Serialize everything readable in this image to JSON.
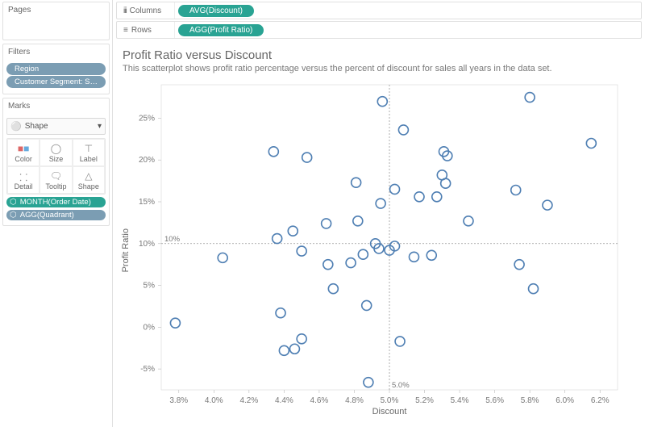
{
  "leftPanel": {
    "pages": {
      "title": "Pages"
    },
    "filters": {
      "title": "Filters",
      "items": [
        "Region",
        "Customer Segment: Small Busin…"
      ]
    },
    "marks": {
      "title": "Marks",
      "shapeSelect": "Shape",
      "grid": [
        "Color",
        "Size",
        "Label",
        "Detail",
        "Tooltip",
        "Shape"
      ],
      "fields": [
        {
          "label": "MONTH(Order Date)",
          "cls": "fp-green"
        },
        {
          "label": "AGG(Quadrant)",
          "cls": "fp-blue"
        }
      ]
    }
  },
  "shelves": {
    "columns": {
      "label": "Columns",
      "pill": "AVG(Discount)"
    },
    "rows": {
      "label": "Rows",
      "pill": "AGG(Profit Ratio)"
    }
  },
  "chart": {
    "title": "Profit Ratio versus Discount",
    "subtitle": "This scatterplot shows profit ratio percentage versus the percent of discount for sales all years in the data set.",
    "ylabel": "Profit Ratio",
    "xlabel": "Discount"
  },
  "chart_data": {
    "type": "scatter",
    "xlabel": "Discount",
    "ylabel": "Profit Ratio",
    "xlim": [
      3.7,
      6.3
    ],
    "ylim": [
      -7.5,
      29
    ],
    "xticks": [
      3.8,
      4.0,
      4.2,
      4.4,
      4.6,
      4.8,
      5.0,
      5.2,
      5.4,
      5.6,
      5.8,
      6.0,
      6.2
    ],
    "yticks": [
      -5,
      0,
      5,
      10,
      15,
      20,
      25
    ],
    "ref_x": {
      "value": 5.0,
      "label": "5.0%"
    },
    "ref_y": {
      "value": 10,
      "label": "10%"
    },
    "points": [
      [
        3.78,
        0.5
      ],
      [
        4.05,
        8.3
      ],
      [
        4.34,
        21.0
      ],
      [
        4.36,
        10.6
      ],
      [
        4.38,
        1.7
      ],
      [
        4.4,
        -2.8
      ],
      [
        4.45,
        11.5
      ],
      [
        4.46,
        -2.6
      ],
      [
        4.5,
        9.1
      ],
      [
        4.5,
        -1.4
      ],
      [
        4.53,
        20.3
      ],
      [
        4.64,
        12.4
      ],
      [
        4.65,
        7.5
      ],
      [
        4.68,
        4.6
      ],
      [
        4.78,
        7.7
      ],
      [
        4.81,
        17.3
      ],
      [
        4.82,
        12.7
      ],
      [
        4.85,
        8.7
      ],
      [
        4.87,
        2.6
      ],
      [
        4.88,
        -6.6
      ],
      [
        4.92,
        10.0
      ],
      [
        4.94,
        9.4
      ],
      [
        4.95,
        14.8
      ],
      [
        4.96,
        27.0
      ],
      [
        5.0,
        9.2
      ],
      [
        5.03,
        16.5
      ],
      [
        5.03,
        9.7
      ],
      [
        5.06,
        -1.7
      ],
      [
        5.08,
        23.6
      ],
      [
        5.14,
        8.4
      ],
      [
        5.17,
        15.6
      ],
      [
        5.24,
        8.6
      ],
      [
        5.27,
        15.6
      ],
      [
        5.3,
        18.2
      ],
      [
        5.31,
        21.0
      ],
      [
        5.32,
        17.2
      ],
      [
        5.33,
        20.5
      ],
      [
        5.45,
        12.7
      ],
      [
        5.72,
        16.4
      ],
      [
        5.74,
        7.5
      ],
      [
        5.8,
        27.5
      ],
      [
        5.82,
        4.6
      ],
      [
        5.9,
        14.6
      ],
      [
        6.15,
        22.0
      ]
    ]
  }
}
